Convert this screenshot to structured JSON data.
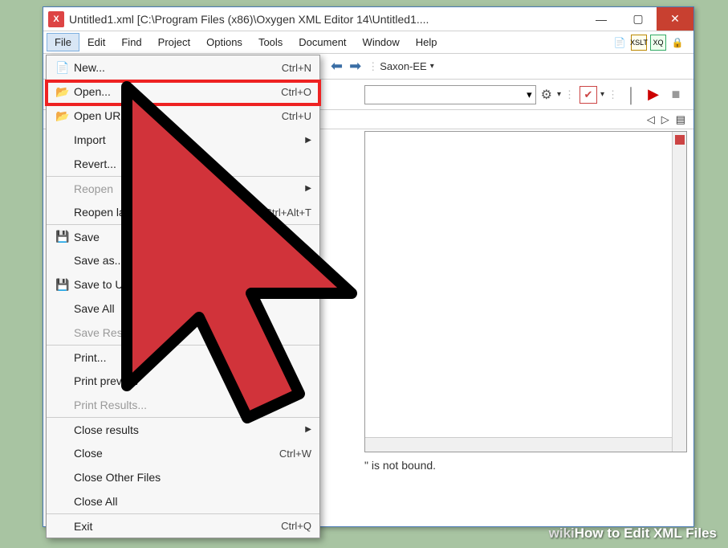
{
  "titlebar": {
    "icon_letter": "X",
    "text": "Untitled1.xml [C:\\Program Files (x86)\\Oxygen XML Editor 14\\Untitled1...."
  },
  "menubar": {
    "items": [
      "File",
      "Edit",
      "Find",
      "Project",
      "Options",
      "Tools",
      "Document",
      "Window",
      "Help"
    ],
    "right_icons": [
      "doc-icon",
      "xslt-icon",
      "xq-icon",
      "lock-icon"
    ],
    "right_labels": [
      "",
      "XSLT",
      "XQ",
      ""
    ]
  },
  "toolbar1": {
    "combo_label": "Saxon-EE"
  },
  "status": {
    "message": "\" is not bound."
  },
  "dropdown": {
    "items": [
      {
        "icon": "📄",
        "label": "New...",
        "shortcut": "Ctrl+N",
        "disabled": false,
        "sep": false,
        "submenu": false
      },
      {
        "icon": "📂",
        "label": "Open...",
        "shortcut": "Ctrl+O",
        "disabled": false,
        "sep": false,
        "submenu": false
      },
      {
        "icon": "📂",
        "label": "Open URL...",
        "shortcut": "Ctrl+U",
        "disabled": false,
        "sep": false,
        "submenu": false
      },
      {
        "icon": "",
        "label": "Import",
        "shortcut": "",
        "disabled": false,
        "sep": false,
        "submenu": true
      },
      {
        "icon": "",
        "label": "Revert...",
        "shortcut": "",
        "disabled": false,
        "sep": false,
        "submenu": false
      },
      {
        "icon": "",
        "label": "Reopen",
        "shortcut": "",
        "disabled": true,
        "sep": true,
        "submenu": true
      },
      {
        "icon": "",
        "label": "Reopen last",
        "shortcut": "Ctrl+Alt+T",
        "disabled": false,
        "sep": false,
        "submenu": false
      },
      {
        "icon": "💾",
        "label": "Save",
        "shortcut": "",
        "disabled": false,
        "sep": true,
        "submenu": false
      },
      {
        "icon": "",
        "label": "Save as...",
        "shortcut": "",
        "disabled": false,
        "sep": false,
        "submenu": false
      },
      {
        "icon": "💾",
        "label": "Save to URL",
        "shortcut": "",
        "disabled": false,
        "sep": false,
        "submenu": false
      },
      {
        "icon": "",
        "label": "Save All",
        "shortcut": "",
        "disabled": false,
        "sep": false,
        "submenu": false
      },
      {
        "icon": "",
        "label": "Save Results",
        "shortcut": "",
        "disabled": true,
        "sep": false,
        "submenu": false
      },
      {
        "icon": "",
        "label": "Print...",
        "shortcut": "",
        "disabled": false,
        "sep": true,
        "submenu": false
      },
      {
        "icon": "",
        "label": "Print preview",
        "shortcut": "",
        "disabled": false,
        "sep": false,
        "submenu": false
      },
      {
        "icon": "",
        "label": "Print Results...",
        "shortcut": "",
        "disabled": true,
        "sep": false,
        "submenu": false
      },
      {
        "icon": "",
        "label": "Close results",
        "shortcut": "",
        "disabled": false,
        "sep": true,
        "submenu": true
      },
      {
        "icon": "",
        "label": "Close",
        "shortcut": "Ctrl+W",
        "disabled": false,
        "sep": false,
        "submenu": false
      },
      {
        "icon": "",
        "label": "Close Other Files",
        "shortcut": "",
        "disabled": false,
        "sep": false,
        "submenu": false
      },
      {
        "icon": "",
        "label": "Close All",
        "shortcut": "",
        "disabled": false,
        "sep": false,
        "submenu": false
      },
      {
        "icon": "",
        "label": "Exit",
        "shortcut": "Ctrl+Q",
        "disabled": false,
        "sep": true,
        "submenu": false
      }
    ]
  },
  "caption": {
    "prefix": "wiki",
    "text": "How to Edit XML Files"
  }
}
